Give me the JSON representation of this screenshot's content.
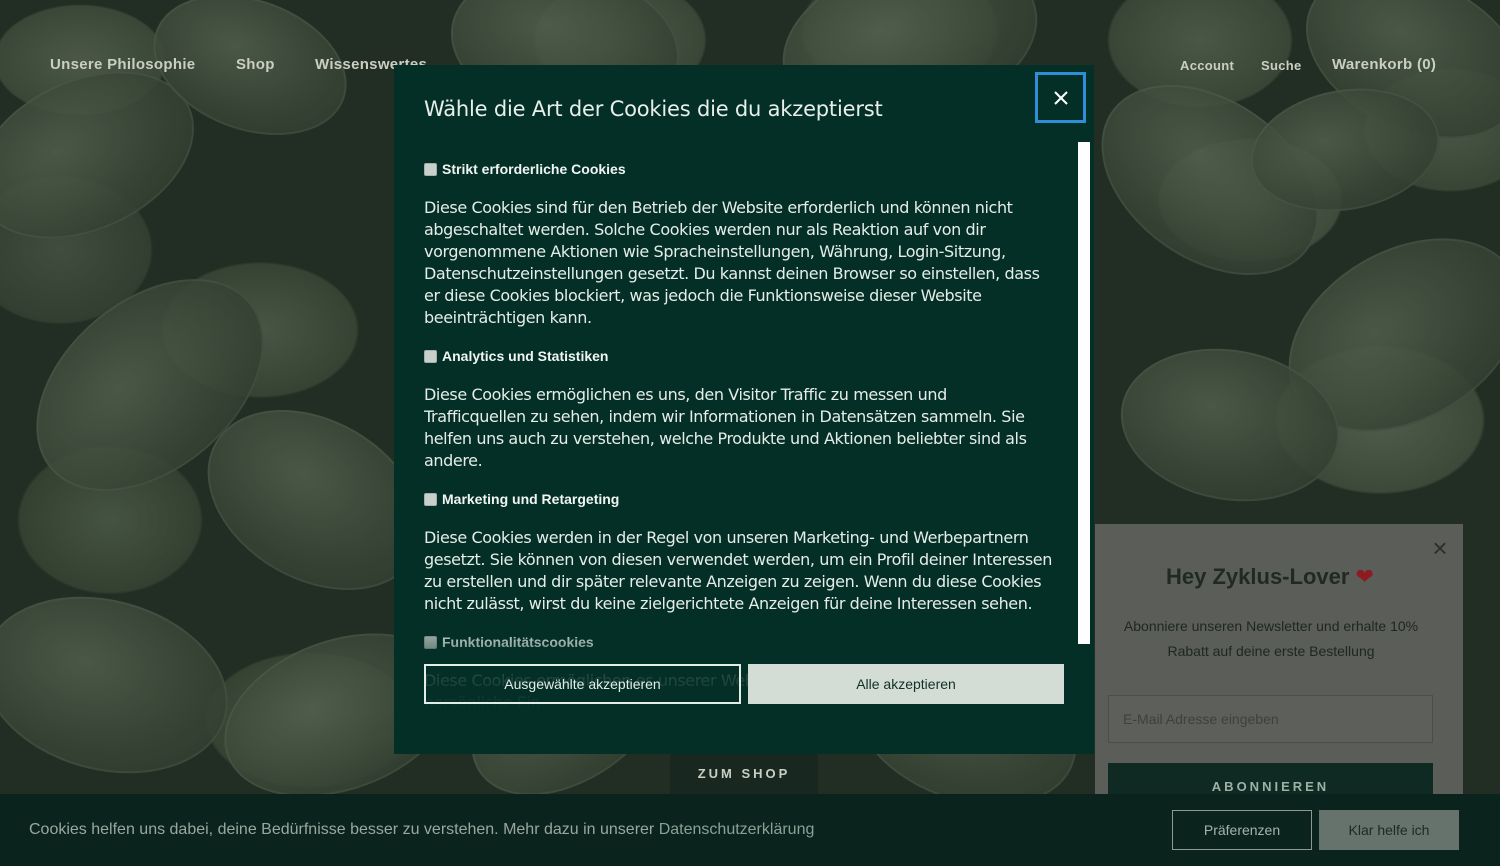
{
  "nav": {
    "items": [
      "Unsere Philosophie",
      "Shop",
      "Wissenswertes"
    ],
    "right": [
      "Account",
      "Suche",
      "Warenkorb (0)"
    ]
  },
  "hero": {
    "shop_button": "ZUM SHOP"
  },
  "modal": {
    "title": "Wähle die Art der Cookies die du akzeptierst",
    "close_icon": "close-icon",
    "sections": [
      {
        "label": "Strikt erforderliche Cookies",
        "checked": false,
        "description": "Diese Cookies sind für den Betrieb der Website erforderlich und können nicht abgeschaltet werden. Solche Cookies werden nur als Reaktion auf von dir vorgenommene Aktionen wie Spracheinstellungen, Währung, Login-Sitzung, Datenschutzeinstellungen gesetzt. Du kannst deinen Browser so einstellen, dass er diese Cookies blockiert, was jedoch die Funktionsweise dieser Website beeinträchtigen kann."
      },
      {
        "label": "Analytics und Statistiken",
        "checked": false,
        "description": "Diese Cookies ermöglichen es uns, den Visitor Traffic zu messen und Trafficquellen zu sehen, indem wir Informationen in Datensätzen sammeln. Sie helfen uns auch zu verstehen, welche Produkte und Aktionen beliebter sind als andere."
      },
      {
        "label": "Marketing und Retargeting",
        "checked": false,
        "description": "Diese Cookies werden in der Regel von unseren Marketing- und Werbepartnern gesetzt. Sie können von diesen verwendet werden, um ein Profil deiner Interessen zu erstellen und dir später relevante Anzeigen zu zeigen. Wenn du diese Cookies nicht zulässt, wirst du keine zielgerichtete Anzeigen für deine Interessen sehen."
      },
      {
        "label": "Funktionalitätscookies",
        "checked": false,
        "description": "Diese Cookies ermöglichen es unserer Website, zusätzliche Funktionen und persönliche Ein-"
      }
    ],
    "btn_selected": "Ausgewählte akzeptieren",
    "btn_all": "Alle akzeptieren"
  },
  "newsletter": {
    "title": "Hey Zyklus-Lover",
    "heart": "❤",
    "text": "Abonniere unseren Newsletter und erhalte 10% Rabatt auf deine erste Bestellung",
    "placeholder": "E-Mail Adresse eingeben",
    "button": "ABONNIEREN",
    "close": "×"
  },
  "cookie_bar": {
    "text": "Cookies helfen uns dabei, deine Bedürfnisse besser zu verstehen. Mehr dazu in unserer",
    "link": "Datenschutzerklärung",
    "btn_pref": "Präferenzen",
    "btn_accept": "Klar helfe ich"
  }
}
